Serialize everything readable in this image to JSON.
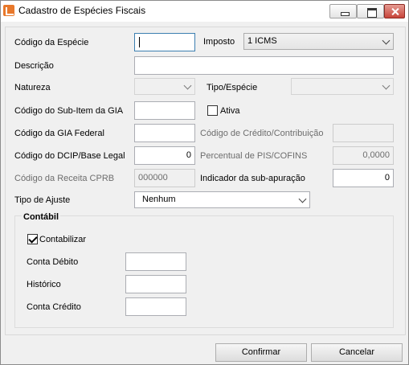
{
  "window": {
    "title": "Cadastro de Espécies Fiscais"
  },
  "form": {
    "codigo_especie": {
      "label": "Código da Espécie",
      "value": ""
    },
    "imposto": {
      "label": "Imposto",
      "value": "1 ICMS"
    },
    "descricao": {
      "label": "Descrição",
      "value": ""
    },
    "natureza": {
      "label": "Natureza",
      "value": ""
    },
    "tipo_especie": {
      "label": "Tipo/Espécie",
      "value": ""
    },
    "codigo_subitem_gia": {
      "label": "Código do Sub-Item da GIA",
      "value": ""
    },
    "ativa": {
      "label": "Ativa",
      "checked": false
    },
    "codigo_gia_federal": {
      "label": "Código da GIA Federal",
      "value": ""
    },
    "codigo_credito": {
      "label": "Código de Crédito/Contribuição",
      "value": ""
    },
    "codigo_dcip": {
      "label": "Código do DCIP/Base Legal",
      "value": "0"
    },
    "percentual_pis": {
      "label": "Percentual de PIS/COFINS",
      "value": "0,0000"
    },
    "codigo_receita_cprb": {
      "label": "Código da Receita CPRB",
      "value": "000000"
    },
    "indicador_subapuracao": {
      "label": "Indicador da sub-apuração",
      "value": "0"
    },
    "tipo_ajuste": {
      "label": "Tipo de Ajuste",
      "value": "Nenhum"
    }
  },
  "contabil": {
    "title": "Contábil",
    "contabilizar": {
      "label": "Contabilizar",
      "checked": true
    },
    "conta_debito": {
      "label": "Conta Débito",
      "value": ""
    },
    "historico": {
      "label": "Histórico",
      "value": ""
    },
    "conta_credito": {
      "label": "Conta Crédito",
      "value": ""
    }
  },
  "buttons": {
    "confirmar": "Confirmar",
    "cancelar": "Cancelar"
  }
}
